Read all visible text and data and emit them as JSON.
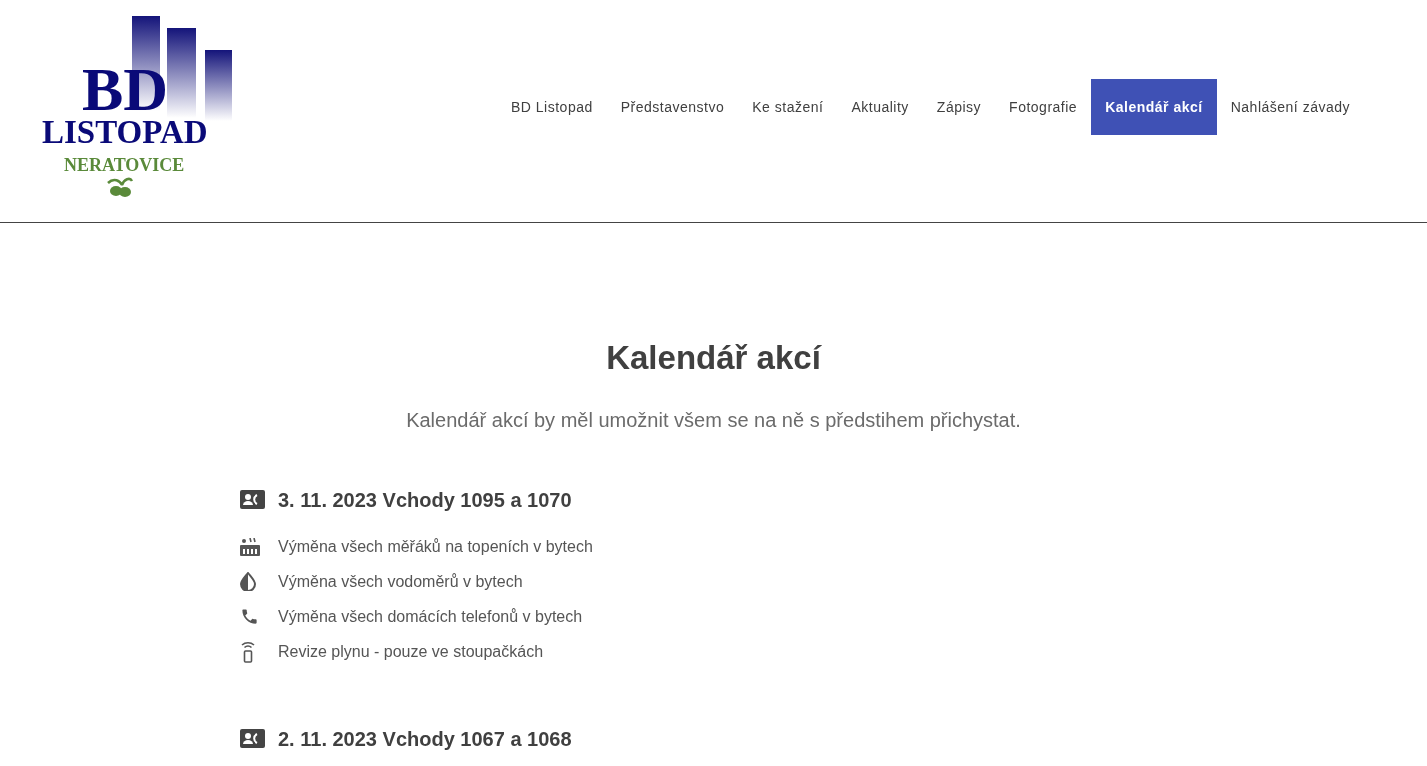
{
  "logo": {
    "initials": "BD",
    "name": "LISTOPAD",
    "town": "NERATOVICE"
  },
  "nav": [
    {
      "label": "BD Listopad",
      "selected": false
    },
    {
      "label": "Představenstvo",
      "selected": false
    },
    {
      "label": "Ke stažení",
      "selected": false
    },
    {
      "label": "Aktuality",
      "selected": false
    },
    {
      "label": "Zápisy",
      "selected": false
    },
    {
      "label": "Fotografie",
      "selected": false
    },
    {
      "label": "Kalendář akcí",
      "selected": true
    },
    {
      "label": "Nahlášení závady",
      "selected": false
    }
  ],
  "page": {
    "title": "Kalendář akcí",
    "subtitle": "Kalendář akcí by měl umožnit všem se na ně s předstihem přichystat."
  },
  "events": [
    {
      "heading": "3. 11. 2023 Vchody 1095 a 1070",
      "items": [
        {
          "kind": "heating",
          "text": "Výměna všech měřáků na topeních v bytech"
        },
        {
          "kind": "water",
          "text": "Výměna všech vodoměrů v bytech"
        },
        {
          "kind": "phone",
          "text": "Výměna všech domácích telefonů v bytech"
        },
        {
          "kind": "gas",
          "text": "Revize plynu - pouze ve stoupačkách"
        }
      ]
    },
    {
      "heading": "2. 11. 2023 Vchody 1067 a 1068"
    }
  ]
}
